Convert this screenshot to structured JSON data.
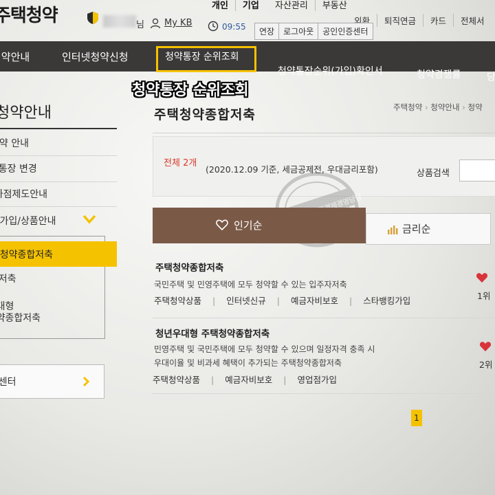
{
  "header": {
    "logo": "주택청약",
    "user_suffix": "님",
    "my_kb": "My KB",
    "time": "09:55",
    "top_menu": [
      "개인",
      "기업",
      "자산관리",
      "부동산",
      "외환",
      "퇴직연금",
      "카드",
      "전체서"
    ],
    "session_buttons": [
      "연장",
      "로그아웃",
      "공인인증센터"
    ]
  },
  "main_nav": {
    "items": [
      "청약안내",
      "인터넷청약신청",
      "청약통장 순위조회",
      "청약통장순위(가입)확인서",
      "청약경쟁률",
      "당"
    ],
    "highlighted": "청약통장 순위조회",
    "highlight_color": "#f5c200"
  },
  "callout": "청약통장 순위조회",
  "sidebar": {
    "title": "청약안내",
    "items": [
      "청약 안내",
      "청약통장 변경",
      "청약가점제도안내",
      "청약통장가입/상품안내"
    ],
    "sub_items": [
      "주택청약종합저축",
      "청약저축",
      "청년우대형 주택청약종합저축"
    ],
    "active": "주택청약종합저축",
    "center": "고객센터"
  },
  "breadcrumb": [
    "주택청약",
    "청약안내",
    "청약"
  ],
  "page": {
    "title": "주택청약종합저축",
    "total_label": "전체",
    "total_count": "2개",
    "basis": "(2020.12.09 기준, 세금공제전, 우대금리포함)",
    "search_label": "상품검색",
    "stamp_text": "부동산그리고경제경영당당"
  },
  "sort_tabs": {
    "popular": "인기순",
    "rate": "금리순"
  },
  "products": [
    {
      "name": "주택청약종합저축",
      "desc": [
        "국민주택 및 민영주택에 모두 청약할 수 있는 입주자저축"
      ],
      "tags": [
        "주택청약상품",
        "인터넷신규",
        "예금자비보호",
        "스타뱅킹가입"
      ],
      "rank": "1위"
    },
    {
      "name": "청년우대형 주택청약종합저축",
      "desc": [
        "민영주택 및 국민주택에 모두 청약할 수 있으며 일정자격 충족 시",
        "우대이율 및 비과세 혜택이 추가되는 주택청약종합저축"
      ],
      "tags": [
        "주택청약상품",
        "예금자비보호",
        "영업점가입"
      ],
      "rank": "2위"
    }
  ],
  "pagination": {
    "current": "1"
  },
  "colors": {
    "nav_bg": "#3b3838",
    "accent_yellow": "#f5c200",
    "tab_brown": "#7a5a47",
    "heart_red": "#d8343a",
    "total_red": "#d83a2b"
  }
}
